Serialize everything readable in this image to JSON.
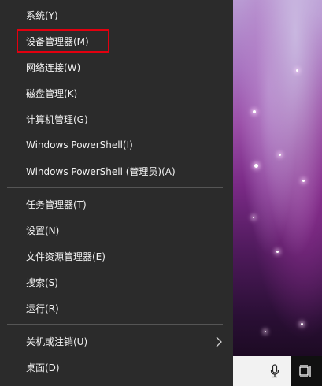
{
  "menu": {
    "items": [
      {
        "label": "系统(Y)"
      },
      {
        "label": "设备管理器(M)"
      },
      {
        "label": "网络连接(W)"
      },
      {
        "label": "磁盘管理(K)"
      },
      {
        "label": "计算机管理(G)"
      },
      {
        "label": "Windows PowerShell(I)"
      },
      {
        "label": "Windows PowerShell (管理员)(A)"
      },
      {
        "label": "任务管理器(T)"
      },
      {
        "label": "设置(N)"
      },
      {
        "label": "文件资源管理器(E)"
      },
      {
        "label": "搜索(S)"
      },
      {
        "label": "运行(R)"
      },
      {
        "label": "关机或注销(U)"
      },
      {
        "label": "桌面(D)"
      }
    ],
    "highlighted_item": "设备管理器(M)"
  },
  "colors": {
    "menu_background": "#2b2b2b",
    "menu_text": "#f2f2f2",
    "divider": "#555555",
    "highlight_border": "#e3000f"
  },
  "icons": {
    "submenu_indicator": "chevron-right-icon",
    "microphone": "microphone-icon",
    "task_view": "task-view-icon"
  }
}
